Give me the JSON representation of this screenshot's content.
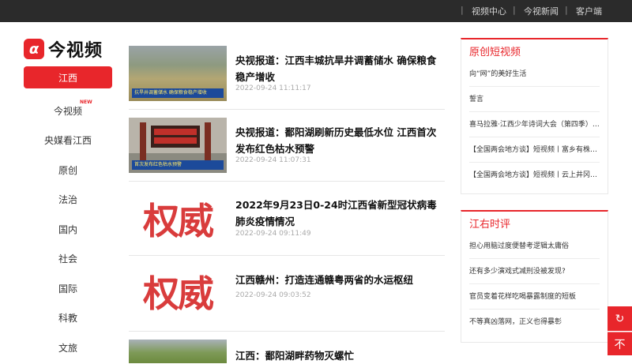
{
  "topbar": {
    "links": [
      "视频中心",
      "今视新闻",
      "客户端"
    ]
  },
  "logo": {
    "mark": "α",
    "name": "今视频"
  },
  "sidenav": {
    "items": [
      {
        "label": "江西",
        "active": true
      },
      {
        "label": "今视频",
        "badge": "NEW"
      },
      {
        "label": "央媒看江西"
      },
      {
        "label": "原创"
      },
      {
        "label": "法治"
      },
      {
        "label": "国内"
      },
      {
        "label": "社会"
      },
      {
        "label": "国际"
      },
      {
        "label": "科教"
      },
      {
        "label": "文旅"
      }
    ]
  },
  "feed": {
    "items": [
      {
        "title": "央视报道：江西丰城抗旱井调蓄储水 确保粮食稳产增收",
        "date": "2022-09-24 11:11:17",
        "thumb_caption": "抗旱井调蓄储水 确保粮食稳产增收"
      },
      {
        "title": "央视报道：鄱阳湖刷新历史最低水位 江西首次发布红色枯水预警",
        "date": "2022-09-24 11:07:31",
        "thumb_caption": "首次发布红色枯水预警"
      },
      {
        "title": "2022年9月23日0-24时江西省新型冠状病毒肺炎疫情情况",
        "date": "2022-09-24 09:11:49",
        "thumb_text": "权威"
      },
      {
        "title": "江西赣州：打造连通赣粤两省的水运枢纽",
        "date": "2022-09-24 09:03:52",
        "thumb_text": "权威"
      },
      {
        "title": "江西：鄱阳湖畔药物灭螺忙",
        "date": ""
      }
    ]
  },
  "panels": {
    "original": {
      "title": "原创短视频",
      "items": [
        "向“网”的美好生活",
        "誓言",
        "喜马拉雅·江西少年诗词大会（第四季）…",
        "【全国两会地方谈】短视频丨富乡有株…",
        "【全国两会地方谈】短视频丨云上井冈…"
      ]
    },
    "commentary": {
      "title": "江右时评",
      "items": [
        "担心用脑过度便替考逻辑太庸俗",
        "还有多少演戏式减刑没被发现?",
        "官员变着花样吃喝暴露制度的短板",
        "不等真凶落网，正义也得暴彰"
      ]
    }
  },
  "float_buttons": {
    "refresh": "↻",
    "top": "不"
  },
  "colors": {
    "brand_red": "#e8262b",
    "topbar_bg": "#2b2b2b",
    "quan_blue": "#2d5aa6"
  }
}
